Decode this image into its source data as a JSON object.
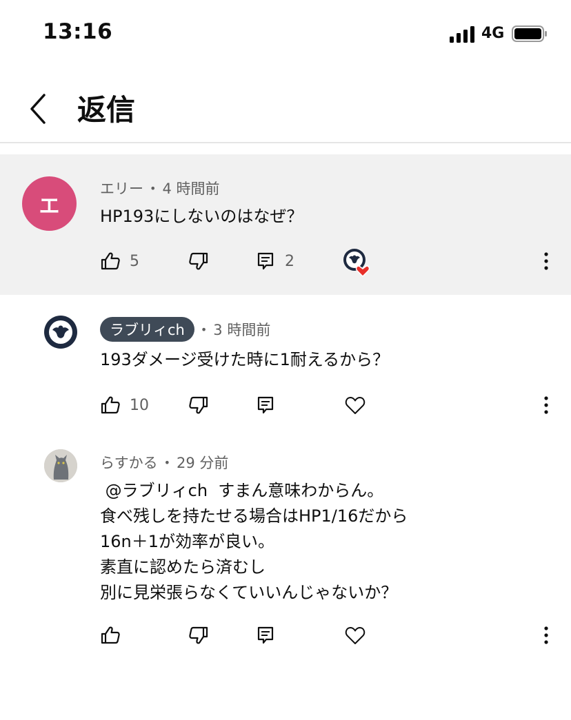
{
  "status_bar": {
    "time": "13:16",
    "network": "4G"
  },
  "header": {
    "title": "返信"
  },
  "comments": [
    {
      "author": "エリー",
      "avatar_letter": "エ",
      "avatar_color": "#d84c7a",
      "time": "4 時間前",
      "text_lines": [
        "HP193にしないのはなぜ？"
      ],
      "likes": "5",
      "replies": "2",
      "creator_heart": true
    },
    {
      "author": "ラブリィch",
      "author_is_creator": true,
      "time": "3 時間前",
      "text_lines": [
        "193ダメージ受けた時に1耐えるから？"
      ],
      "likes": "10"
    },
    {
      "author": "らすかる",
      "time": "29 分前",
      "text_lines": [
        " @ラブリィch  すまん意味わからん。",
        "食べ残しを持たせる場合はHP1/16だから",
        "16n＋1が効率が良い。",
        "素直に認めたら済むし",
        "別に見栄張らなくていいんじゃないか？"
      ]
    }
  ],
  "icons": {
    "like": "thumbs-up-icon",
    "dislike": "thumbs-down-icon",
    "reply": "reply-icon",
    "heart": "heart-icon",
    "more": "more-vert-icon"
  },
  "colors": {
    "heart_red": "#e8302a",
    "badge_bg": "#3f4a57",
    "highlight_bg": "#f1f1f1"
  }
}
